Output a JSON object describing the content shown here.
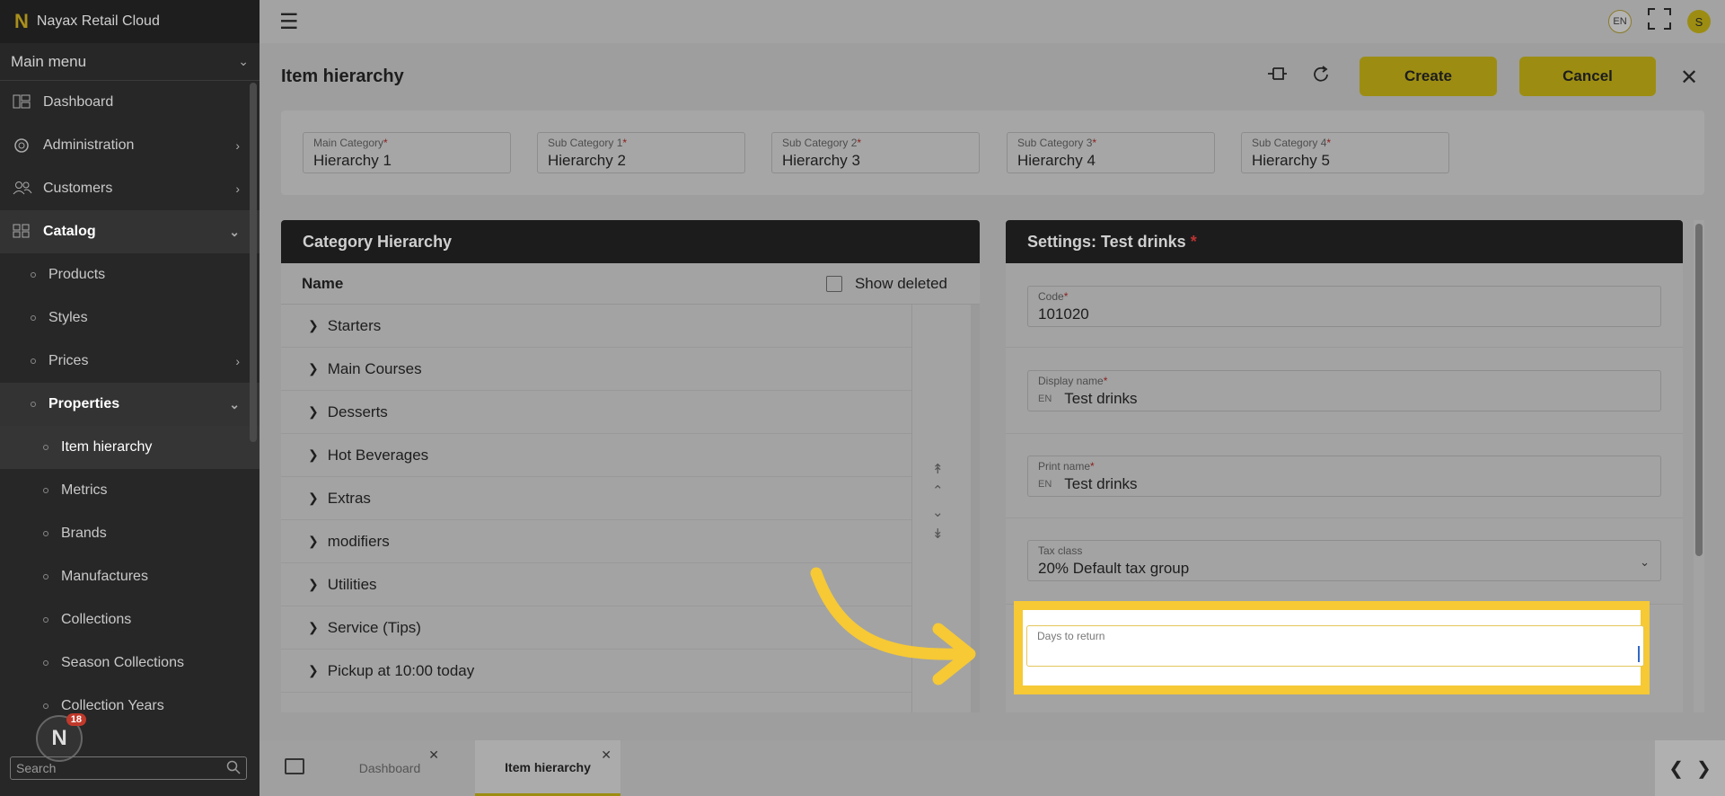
{
  "app": {
    "title": "Nayax Retail Cloud",
    "logo": "N"
  },
  "sidebar": {
    "main_menu": "Main menu",
    "items": [
      {
        "label": "Dashboard",
        "icon": "dashboard-icon"
      },
      {
        "label": "Administration",
        "icon": "gear-icon"
      },
      {
        "label": "Customers",
        "icon": "users-icon"
      },
      {
        "label": "Catalog",
        "icon": "grid-icon"
      },
      {
        "label": "Products"
      },
      {
        "label": "Styles"
      },
      {
        "label": "Prices"
      },
      {
        "label": "Properties"
      },
      {
        "label": "Item hierarchy"
      },
      {
        "label": "Metrics"
      },
      {
        "label": "Brands"
      },
      {
        "label": "Manufactures"
      },
      {
        "label": "Collections"
      },
      {
        "label": "Season Collections"
      },
      {
        "label": "Collection Years"
      }
    ],
    "notifications_count": "18",
    "search_placeholder": "Search"
  },
  "topbar": {
    "language": "EN",
    "user_initial": "S"
  },
  "page": {
    "title": "Item hierarchy",
    "create_label": "Create",
    "cancel_label": "Cancel"
  },
  "categories": [
    {
      "label": "Main Category",
      "value": "Hierarchy 1"
    },
    {
      "label": "Sub Category 1",
      "value": "Hierarchy 2"
    },
    {
      "label": "Sub Category 2",
      "value": "Hierarchy 3"
    },
    {
      "label": "Sub Category 3",
      "value": "Hierarchy 4"
    },
    {
      "label": "Sub Category 4",
      "value": "Hierarchy 5"
    }
  ],
  "tree": {
    "title": "Category Hierarchy",
    "name_header": "Name",
    "show_deleted": "Show deleted",
    "rows": [
      "Starters",
      "Main Courses",
      "Desserts",
      "Hot Beverages",
      "Extras",
      "modifiers",
      "Utilities",
      "Service (Tips)",
      "Pickup at 10:00 today"
    ]
  },
  "settings": {
    "title": "Settings: Test drinks",
    "code_label": "Code",
    "code_value": "101020",
    "display_name_label": "Display name",
    "display_name_value": "Test drinks",
    "print_name_label": "Print name",
    "print_name_value": "Test drinks",
    "lang_tag": "EN",
    "tax_class_label": "Tax class",
    "tax_class_value": "20% Default tax group",
    "days_to_return_label": "Days to return"
  },
  "tabs": {
    "dashboard": "Dashboard",
    "item_hierarchy": "Item hierarchy"
  },
  "colors": {
    "accent": "#f6c935",
    "brand": "#9c8d12"
  }
}
